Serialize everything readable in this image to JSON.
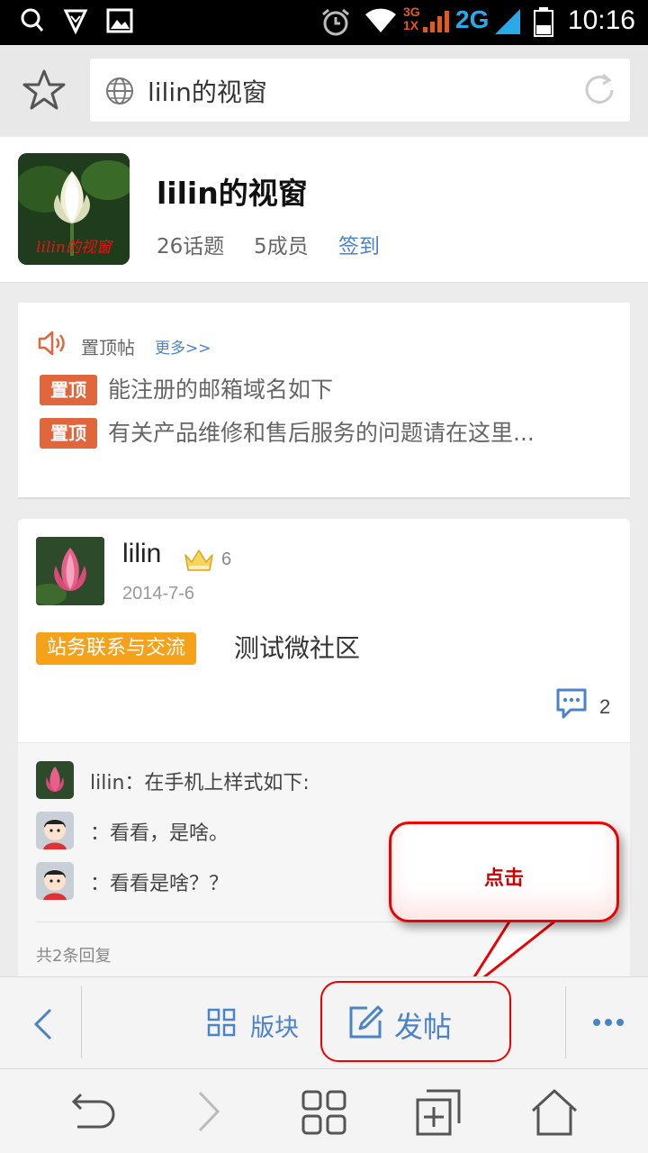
{
  "status_bar": {
    "time": "10:16",
    "network_type": "2G",
    "network_sub": [
      "3G",
      "1X"
    ],
    "icons": [
      "search-icon",
      "shield-icon",
      "image-icon",
      "alarm-icon",
      "wifi-icon",
      "signal-icon",
      "battery-icon"
    ]
  },
  "address_bar": {
    "page_title": "lilin的视窗",
    "icons": [
      "star-icon",
      "globe-icon",
      "refresh-icon"
    ]
  },
  "forum": {
    "title": "lilin的视窗",
    "avatar_caption": "lilin的视窗",
    "topics": "26话题",
    "members": "5成员",
    "signin": "签到"
  },
  "pinned": {
    "label": "置顶帖",
    "more": "更多>>",
    "items": [
      {
        "badge": "置顶",
        "text": "能注册的邮箱域名如下"
      },
      {
        "badge": "置顶",
        "text": "有关产品维修和售后服务的问题请在这里..."
      }
    ]
  },
  "post": {
    "author": "lilin",
    "level": "6",
    "date": "2014-7-6",
    "category": "站务联系与交流",
    "title": "测试微社区",
    "comment_count": "2",
    "replies": [
      {
        "text": "lilin：在手机上样式如下:"
      },
      {
        "text": "：看看，是啥。"
      },
      {
        "text": "：看看是啥？？"
      }
    ],
    "reply_total": "共2条回复"
  },
  "callout": {
    "text": "点击"
  },
  "action_bar": {
    "board": "版块",
    "new_post": "发帖"
  },
  "colors": {
    "accent": "#4a83c8",
    "pin_badge": "#e0663c",
    "category": "#f5a11a",
    "annotation": "#e00000"
  }
}
